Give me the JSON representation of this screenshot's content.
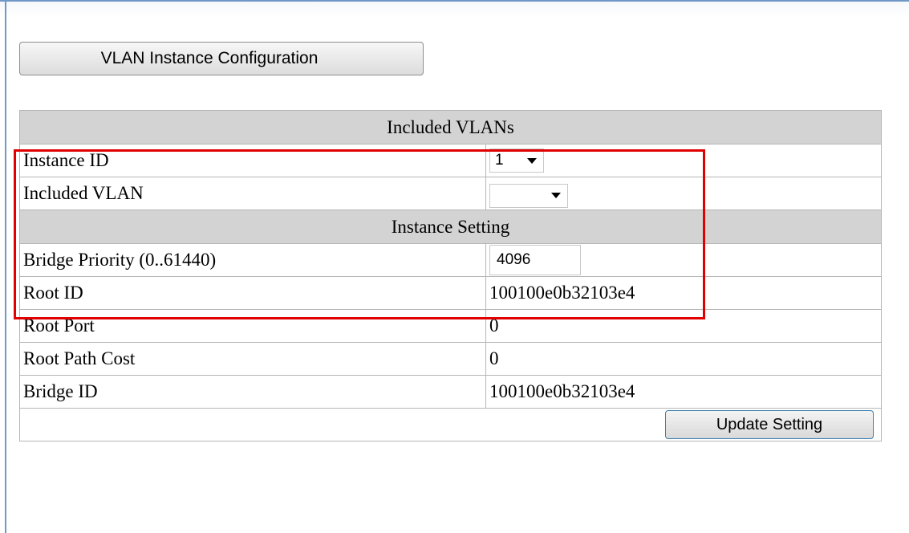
{
  "header": {
    "config_button": "VLAN Instance Configuration"
  },
  "sections": {
    "included_vlans": "Included VLANs",
    "instance_setting": "Instance Setting"
  },
  "fields": {
    "instance_id": {
      "label": "Instance ID",
      "value": "1"
    },
    "included_vlan": {
      "label": "Included VLAN",
      "value": ""
    },
    "bridge_priority": {
      "label": "Bridge Priority (0..61440)",
      "value": "4096"
    },
    "root_id": {
      "label": "Root ID",
      "value": "100100e0b32103e4"
    },
    "root_port": {
      "label": "Root Port",
      "value": "0"
    },
    "root_path_cost": {
      "label": "Root Path Cost",
      "value": "0"
    },
    "bridge_id": {
      "label": "Bridge ID",
      "value": "100100e0b32103e4"
    }
  },
  "actions": {
    "update_button": "Update Setting"
  },
  "colors": {
    "highlight": "#e00000",
    "section_bg": "#d3d3d3",
    "frame_accent": "#6f98c9"
  }
}
